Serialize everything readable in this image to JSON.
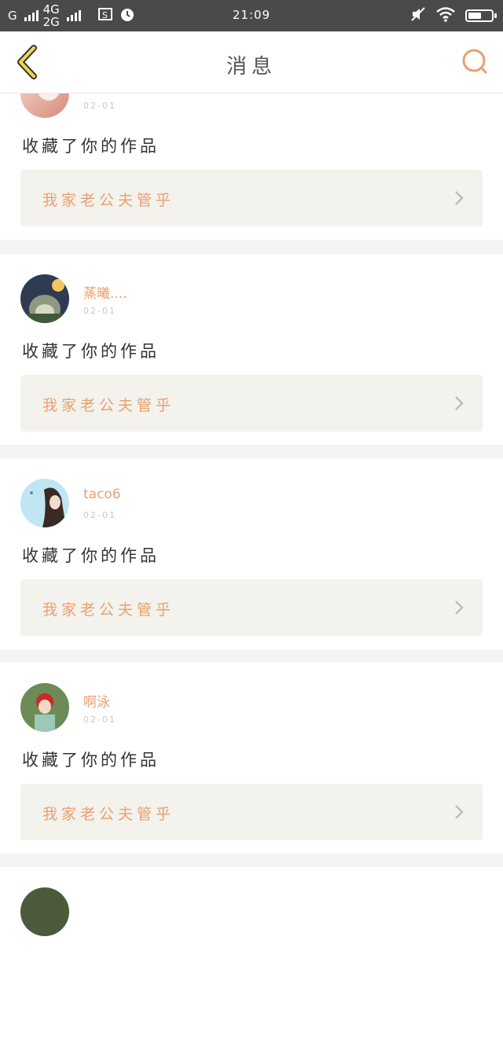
{
  "status_bar": {
    "carrier1": "G",
    "carrier2_top": "4G",
    "carrier2_bottom": "2G",
    "time": "21:09"
  },
  "header": {
    "title": "消息"
  },
  "messages": [
    {
      "name": "",
      "date": "02-01",
      "action": "收藏了你的作品",
      "work_title": "我家老公夫管乎",
      "avatar_colors": [
        "#f3d6cc",
        "#d98a7a"
      ]
    },
    {
      "name": "蒸曦....",
      "date": "02-01",
      "action": "收藏了你的作品",
      "work_title": "我家老公夫管乎",
      "avatar_colors": [
        "#2e3b52",
        "#8d9a80"
      ]
    },
    {
      "name": "taco6",
      "date": "02-01",
      "action": "收藏了你的作品",
      "work_title": "我家老公夫管乎",
      "avatar_colors": [
        "#bfe6f2",
        "#3a2a25"
      ]
    },
    {
      "name": "啊泳",
      "date": "02-01",
      "action": "收藏了你的作品",
      "work_title": "我家老公夫管乎",
      "avatar_colors": [
        "#6e8a56",
        "#c82a2a"
      ]
    }
  ],
  "colors": {
    "accent": "#e9a070",
    "back_arrow": "#f3d64a",
    "card_link_bg": "#f3f2ec"
  }
}
